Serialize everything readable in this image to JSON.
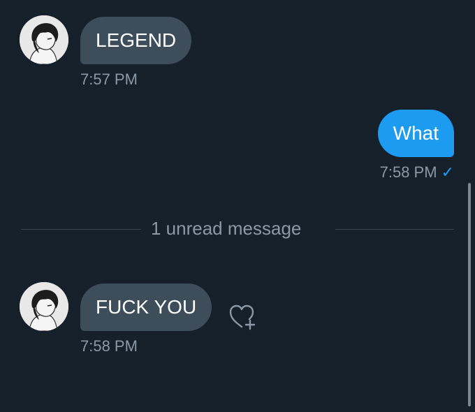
{
  "conversation": {
    "messages": [
      {
        "direction": "received",
        "text": "LEGEND",
        "time": "7:57 PM",
        "avatar_icon": "user-avatar"
      },
      {
        "direction": "sent",
        "text": "What",
        "time": "7:58 PM",
        "status_icon": "checkmark-icon",
        "status_glyph": "✓"
      },
      {
        "direction": "received",
        "text": "FUCK YOU",
        "time": "7:58 PM",
        "avatar_icon": "user-avatar",
        "reaction_icon": "heart-plus-icon"
      }
    ],
    "unread_divider": "1 unread message"
  },
  "colors": {
    "background": "#15202b",
    "received_bubble": "#3e4d5a",
    "sent_bubble": "#1d9bf0",
    "muted_text": "#8b98a5",
    "accent": "#1d9bf0"
  }
}
